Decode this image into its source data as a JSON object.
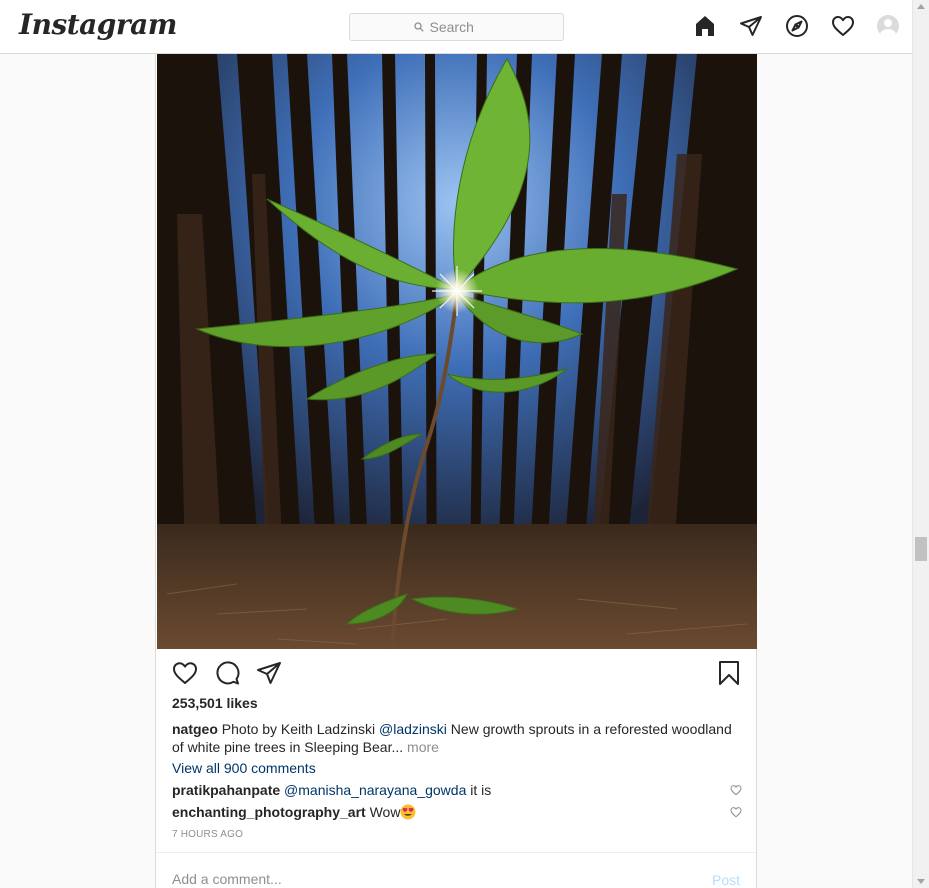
{
  "header": {
    "logo": "Instagram",
    "search_placeholder": "Search",
    "nav_icons": [
      "home-icon",
      "direct-icon",
      "explore-icon",
      "activity-heart-icon",
      "profile-avatar"
    ]
  },
  "post": {
    "author": "natgeo",
    "likes": "253,501 likes",
    "caption": {
      "prefix": "Photo by Keith Ladzinski",
      "mention": "@ladzinski",
      "text": "New growth sprouts in a reforested woodland of white pine trees in Sleeping Bear...",
      "more_label": "more"
    },
    "view_all_comments": "View all 900 comments",
    "comments": [
      {
        "user": "pratikpahanpate",
        "mention": "@manisha_narayana_gowda",
        "text": "it is"
      },
      {
        "user": "enchanting_photography_art",
        "text": "Wow"
      }
    ],
    "timestamp": "7 HOURS AGO",
    "comment_placeholder": "Add a comment...",
    "post_label": "Post"
  },
  "colors": {
    "link": "#003569",
    "muted": "#8e8e8e",
    "border": "#dbdbdb",
    "post_button_disabled": "#b2dffc"
  }
}
